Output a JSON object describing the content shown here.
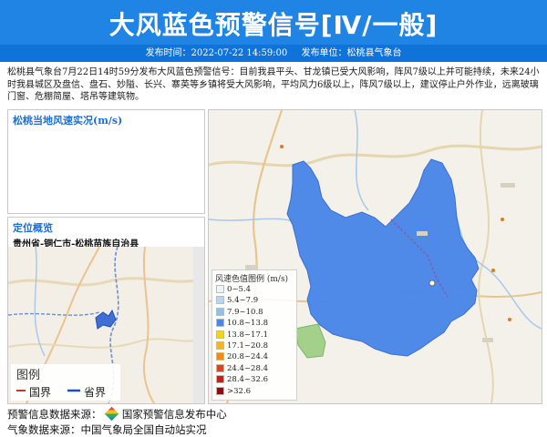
{
  "header": {
    "title": "大风蓝色预警信号[Ⅳ/一般]",
    "publish_time_label": "发布时间：2022-07-22 14:59:00",
    "publish_unit_label": "发布单位：松桃县气象台"
  },
  "description": "松桃县气象台7月22日14时59分发布大风蓝色预警信号：目前我县平头、甘龙镇已受大风影响，阵风7级以上并可能持续，未来24小时我县城区及盘信、盘石、妙隘、长兴、寨英等乡镇将受大风影响，平均风力6级以上，阵风7级以上，建议停止户外作业，远离玻璃门窗、危棚简屋、塔吊等建筑物。",
  "wind_panel": {
    "title": "松桃当地风速实况(m/s)"
  },
  "location_panel": {
    "title": "定位概览",
    "subtitle": "贵州省-铜仁市-松桃苗族自治县"
  },
  "inset_legend": {
    "title": "图例",
    "items": [
      "国界",
      "省界"
    ],
    "colors": [
      "#c0392b",
      "#1f4fb0"
    ]
  },
  "wind_legend": {
    "title": "风速色值图例 (m/s)",
    "items": [
      {
        "label": "0~5.4",
        "color": "#eef4fb"
      },
      {
        "label": "5.4~7.9",
        "color": "#b7d6f3"
      },
      {
        "label": "7.9~10.8",
        "color": "#8fc0ee"
      },
      {
        "label": "10.8~13.8",
        "color": "#4a86e8"
      },
      {
        "label": "13.8~17.1",
        "color": "#f4d21f"
      },
      {
        "label": "17.1~20.8",
        "color": "#f4b520"
      },
      {
        "label": "20.8~24.4",
        "color": "#f08a1c"
      },
      {
        "label": "24.4~28.4",
        "color": "#e0421e"
      },
      {
        "label": "28.4~32.6",
        "color": "#c91c1c"
      },
      {
        "label": ">32.6",
        "color": "#8a0f0f"
      }
    ]
  },
  "footer": {
    "source_label": "预警信息数据来源：",
    "source_name": "国家预警信息发布中心",
    "weather_source": "气象数据来源：中国气象局全国自动站实况"
  }
}
